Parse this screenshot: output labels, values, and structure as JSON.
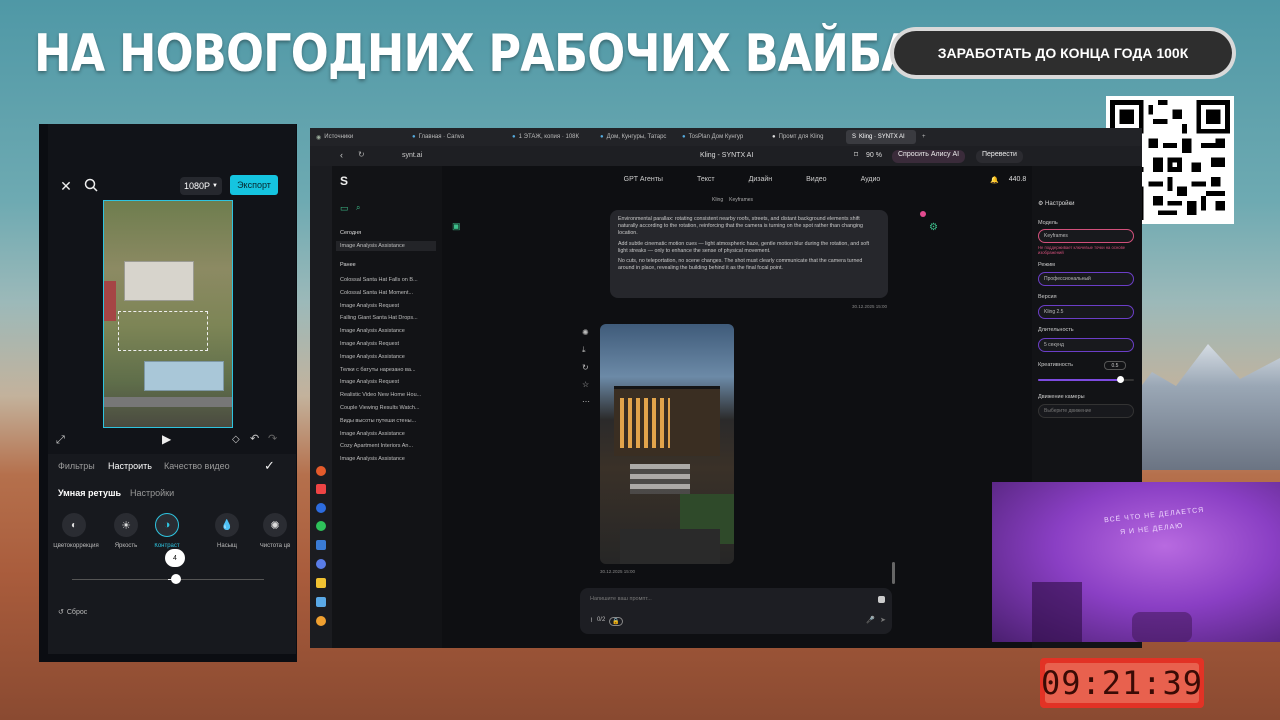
{
  "headline": "НА НОВОГОДНИХ РАБОЧИХ ВАЙБАХ",
  "promo_button": "ЗАРАБОТАТЬ ДО КОНЦА ГОДА 100К",
  "timer": "09:21:39",
  "webcam": {
    "wall_text_1": "ВСЁ ЧТО НЕ ДЕЛАЕТСЯ",
    "wall_text_2": "Я И НЕ ДЕЛАЮ"
  },
  "editor": {
    "resolution": "1080P",
    "export_label": "Экспорт",
    "tabs": [
      "Фильтры",
      "Настроить",
      "Качество видео"
    ],
    "subtabs": [
      "Умная ретушь",
      "Настройки"
    ],
    "tools": [
      "Цветокоррекция",
      "Яркость",
      "Контраст",
      "Насыщ",
      "Чистота цв"
    ],
    "slider_value": "4",
    "slider_fraction": 0.54,
    "reset_label": "Сброс"
  },
  "browser": {
    "tabs": [
      "Источники",
      "Главная · Canva",
      "1 ЭТАЖ, копия · 108К",
      "Дом, Кунгуры, Татарс",
      "TosPlan Дом Кунгур",
      "Промт для Kling",
      "Kling · SYNTX AI"
    ],
    "url": "synt.ai",
    "page_title": "Kling - SYNTX AI",
    "zoom": "90 %",
    "ask_alice": "Спросить Алису AI",
    "translate": "Перевести",
    "nav": [
      "GPT Агенты",
      "Текст",
      "Дизайн",
      "Видео",
      "Аудио"
    ],
    "balance": "440.8",
    "crumbs": [
      "Kling",
      "Keyframes"
    ],
    "sidebar": {
      "today_label": "Сегодня",
      "today_items": [
        "Image Analysis Assistance"
      ],
      "earlier_label": "Ранее",
      "items": [
        "Colossal Santa Hat Falls on B...",
        "Colossal Santa Hat Moment...",
        "Image Analysis Request",
        "Falling Giant Santa Hat Drops...",
        "Image Analysis Assistance",
        "Image Analysis Request",
        "Image Analysis Assistance",
        "Телки с батуты нарезано ва...",
        "Image Analysis Request",
        "Realistic Video New Home Hou...",
        "Couple Viewing Results Watch...",
        "Виды высоты путеши стены...",
        "Image Analysis Assistance",
        "Cozy Apartment Interiors An...",
        "Image Analysis Assistance"
      ]
    },
    "message": {
      "p1": "Environmental parallax: rotating consistent nearby roofs, streets, and distant background elements shift naturally according to the rotation, reinforcing that the camera is turning on the spot rather than changing location.",
      "p2": "Add subtle cinematic motion cues — light atmospheric haze, gentle motion blur during the rotation, and soft light streaks — only to enhance the sense of physical movement.",
      "p3": "No cuts, no teleportation, no scene changes. The shot must clearly communicate that the camera turned around in place, revealing the building behind it as the final focal point.",
      "time": "30.12.2025 15:00"
    },
    "image_time": "30.12.2025 15:00",
    "input_placeholder": "Напишите ваш промпт...",
    "input_count": "0/2",
    "settings": {
      "title": "Настройки",
      "model_label": "Модель",
      "model_value": "Keyframes",
      "model_warning": "Не поддерживает ключевые точки на основе изображений",
      "mode_label": "Режим",
      "mode_value": "Профессиональный",
      "version_label": "Версия",
      "version_value": "Kling 2.5",
      "duration_label": "Длительность",
      "duration_value": "5 секунд",
      "creativity_label": "Креативность",
      "creativity_value": "0.5",
      "creativity_fraction": 0.85,
      "camera_label": "Движение камеры",
      "camera_value": "Выберите движение"
    }
  }
}
